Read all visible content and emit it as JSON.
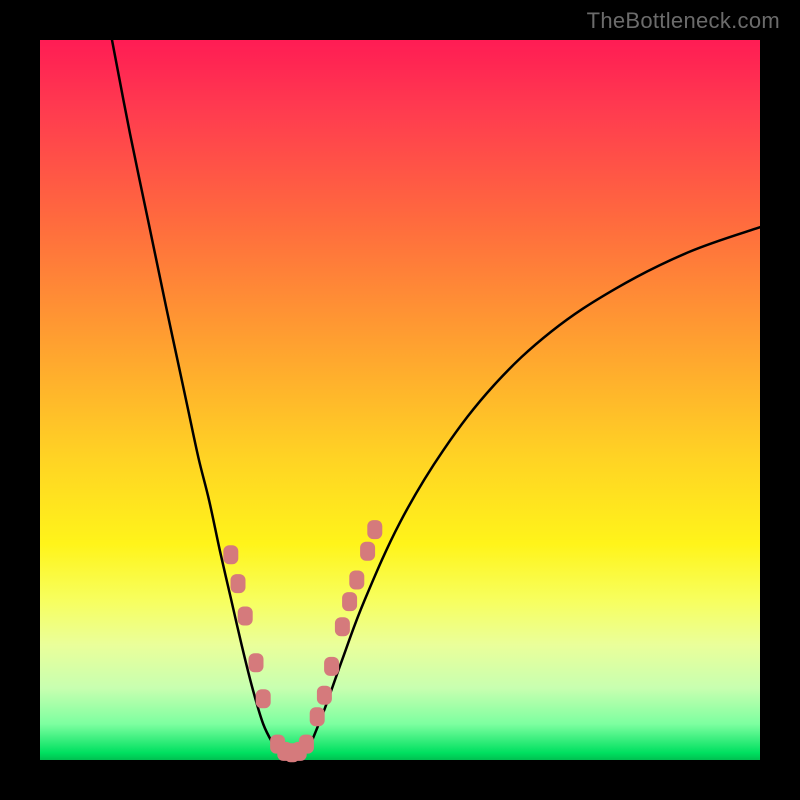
{
  "watermark": "TheBottleneck.com",
  "chart_data": {
    "type": "line",
    "title": "",
    "xlabel": "",
    "ylabel": "",
    "xlim": [
      0,
      100
    ],
    "ylim": [
      0,
      100
    ],
    "background_gradient": {
      "top": "#ff1c54",
      "mid": "#ffd324",
      "bottom": "#00c050"
    },
    "series": [
      {
        "name": "left-branch",
        "x": [
          10.0,
          12.5,
          15.0,
          17.5,
          19.0,
          20.5,
          22.0,
          23.5,
          25.0,
          26.5,
          28.0,
          29.5,
          31.0,
          32.5
        ],
        "values": [
          100.0,
          87.0,
          75.0,
          63.0,
          56.0,
          49.0,
          42.0,
          36.0,
          29.0,
          22.5,
          16.0,
          10.0,
          5.0,
          2.0
        ]
      },
      {
        "name": "valley-floor",
        "x": [
          32.5,
          33.5,
          34.5,
          35.5,
          36.5,
          37.5
        ],
        "values": [
          2.0,
          0.8,
          0.4,
          0.4,
          0.8,
          2.0
        ]
      },
      {
        "name": "right-branch",
        "x": [
          37.5,
          39.5,
          42.0,
          45.0,
          50.0,
          56.0,
          63.0,
          71.0,
          80.0,
          90.0,
          100.0
        ],
        "values": [
          2.0,
          7.0,
          14.0,
          22.0,
          33.0,
          43.0,
          52.0,
          59.5,
          65.5,
          70.5,
          74.0
        ]
      }
    ],
    "markers": [
      {
        "x": 26.5,
        "y": 28.5
      },
      {
        "x": 27.5,
        "y": 24.5
      },
      {
        "x": 28.5,
        "y": 20.0
      },
      {
        "x": 30.0,
        "y": 13.5
      },
      {
        "x": 31.0,
        "y": 8.5
      },
      {
        "x": 33.0,
        "y": 2.2
      },
      {
        "x": 34.0,
        "y": 1.2
      },
      {
        "x": 35.0,
        "y": 1.0
      },
      {
        "x": 36.0,
        "y": 1.2
      },
      {
        "x": 37.0,
        "y": 2.2
      },
      {
        "x": 38.5,
        "y": 6.0
      },
      {
        "x": 39.5,
        "y": 9.0
      },
      {
        "x": 40.5,
        "y": 13.0
      },
      {
        "x": 42.0,
        "y": 18.5
      },
      {
        "x": 43.0,
        "y": 22.0
      },
      {
        "x": 44.0,
        "y": 25.0
      },
      {
        "x": 45.5,
        "y": 29.0
      },
      {
        "x": 46.5,
        "y": 32.0
      }
    ]
  }
}
